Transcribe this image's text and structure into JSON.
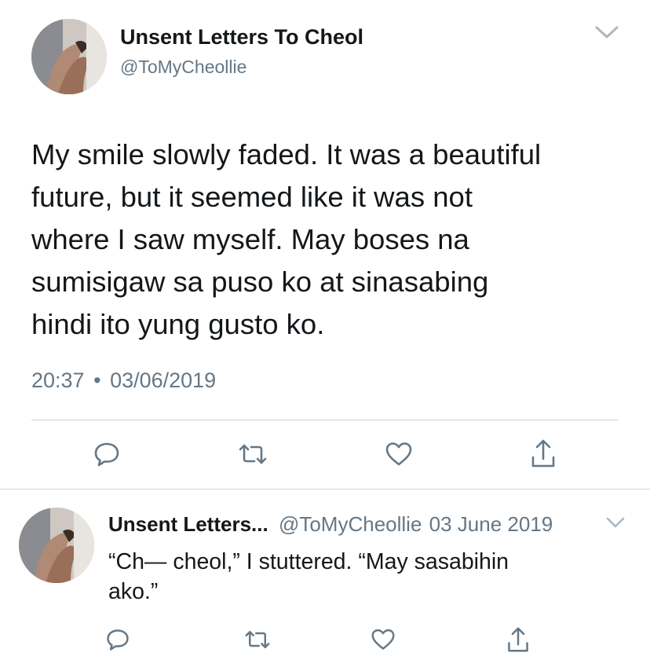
{
  "main_tweet": {
    "display_name": "Unsent Letters To Cheol",
    "handle": "@ToMyCheollie",
    "text_lines": [
      "My smile slowly faded. It was a beautiful",
      "future, but it seemed like it was not",
      "where I saw myself. May boses na",
      "sumisigaw sa puso ko at sinasabing",
      "hindi ito yung gusto ko."
    ],
    "time": "20:37",
    "separator": "•",
    "date": "03/06/2019",
    "icons": [
      "reply-icon",
      "retweet-icon",
      "like-icon",
      "share-icon"
    ]
  },
  "reply_tweet": {
    "display_name": "Unsent Letters...",
    "handle": "@ToMyCheollie",
    "date": "03 June 2019",
    "text_lines": [
      "“Ch— cheol,” I stuttered. “May sasabihin",
      "ako.”"
    ],
    "icons": [
      "reply-icon",
      "retweet-icon",
      "like-icon",
      "share-icon"
    ]
  },
  "colors": {
    "text": "#14171a",
    "secondary": "#657786",
    "divider": "#cfd6dc",
    "icon": "#657786"
  }
}
